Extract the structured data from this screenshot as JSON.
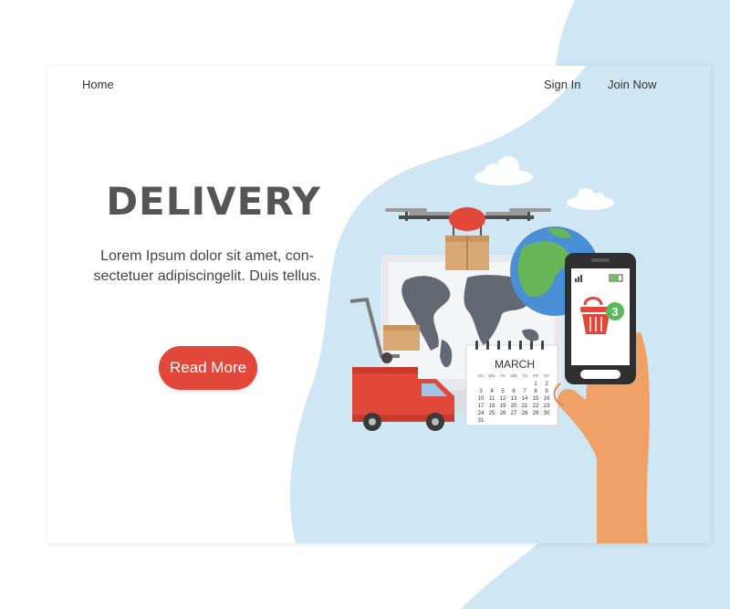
{
  "nav": {
    "home": "Home",
    "sign_in": "Sign In",
    "join_now": "Join Now"
  },
  "hero": {
    "title": "DELIVERY",
    "text": "Lorem Ipsum dolor sit amet, con-sectetuer adipiscingelit. Duis tellus.",
    "button": "Read More"
  },
  "calendar": {
    "month": "MARCH",
    "weekdays": [
      "SU",
      "MO",
      "TU",
      "WE",
      "TH",
      "FR",
      "SA"
    ],
    "weeks": [
      [
        "",
        "",
        "",
        "",
        "",
        "1",
        "2"
      ],
      [
        "3",
        "4",
        "5",
        "6",
        "7",
        "8",
        "9"
      ],
      [
        "10",
        "11",
        "12",
        "13",
        "14",
        "15",
        "16"
      ],
      [
        "17",
        "18",
        "19",
        "20",
        "21",
        "22",
        "23"
      ],
      [
        "24",
        "25",
        "26",
        "27",
        "28",
        "29",
        "30"
      ],
      [
        "31",
        "",
        "",
        "",
        "",
        "",
        ""
      ]
    ]
  },
  "phone": {
    "cart_badge": "3"
  },
  "colors": {
    "accent": "#e2483a",
    "sky": "#cfe6f5",
    "title": "#555555"
  }
}
